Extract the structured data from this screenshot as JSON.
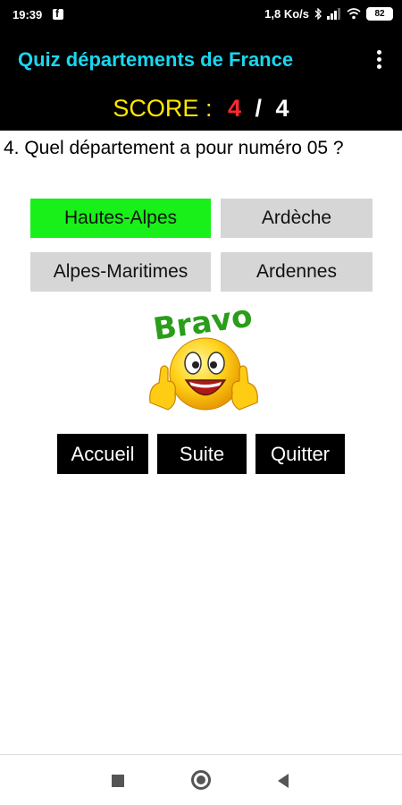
{
  "status_bar": {
    "time": "19:39",
    "network_speed": "1,8 Ko/s",
    "battery": "82"
  },
  "app_bar": {
    "title": "Quiz départements de France"
  },
  "score": {
    "label": "SCORE :",
    "current": "4",
    "separator": "/",
    "total": "4"
  },
  "question": {
    "text": "4. Quel département a pour numéro 05 ?"
  },
  "answers": [
    {
      "label": "Hautes-Alpes",
      "state": "correct"
    },
    {
      "label": "Ardèche",
      "state": "neutral"
    },
    {
      "label": "Alpes-Maritimes",
      "state": "neutral"
    },
    {
      "label": "Ardennes",
      "state": "neutral"
    }
  ],
  "feedback": {
    "image_text": "Bravo"
  },
  "nav_buttons": {
    "home": "Accueil",
    "next": "Suite",
    "quit": "Quitter"
  },
  "colors": {
    "title": "#19d7f0",
    "score_label": "#ffe600",
    "score_current": "#ff2a2a",
    "correct_answer": "#19f019",
    "answer_bg": "#d6d6d6",
    "bravo_text": "#2a9d1a"
  }
}
